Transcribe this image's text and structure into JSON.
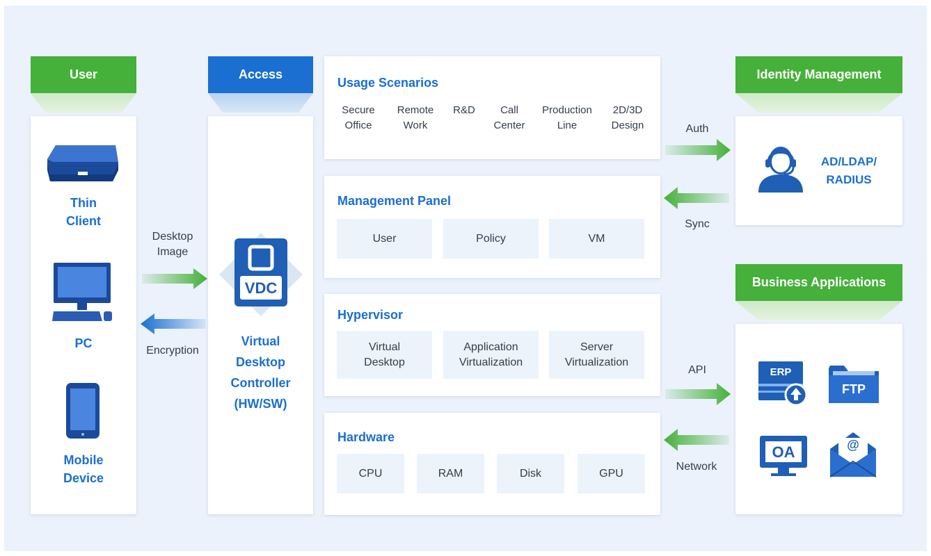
{
  "user_column": {
    "header": "User",
    "items": [
      {
        "label": "Thin\nClient",
        "icon": "thin-client-icon"
      },
      {
        "label": "PC",
        "icon": "pc-icon"
      },
      {
        "label": "Mobile\nDevice",
        "icon": "mobile-device-icon"
      }
    ]
  },
  "access_column": {
    "header": "Access",
    "logo_text": "VDC",
    "label": "Virtual\nDesktop\nController\n(HW/SW)"
  },
  "flows_left": {
    "desktop_image": "Desktop\nImage",
    "encryption": "Encryption"
  },
  "usage_scenarios": {
    "title": "Usage Scenarios",
    "items": [
      "Secure\nOffice",
      "Remote\nWork",
      "R&D",
      "Call\nCenter",
      "Production\nLine",
      "2D/3D\nDesign"
    ]
  },
  "management_panel": {
    "title": "Management Panel",
    "items": [
      "User",
      "Policy",
      "VM"
    ]
  },
  "hypervisor": {
    "title": "Hypervisor",
    "items": [
      "Virtual\nDesktop",
      "Application\nVirtualization",
      "Server\nVirtualization"
    ]
  },
  "hardware": {
    "title": "Hardware",
    "items": [
      "CPU",
      "RAM",
      "Disk",
      "GPU"
    ]
  },
  "flows_right": {
    "auth": "Auth",
    "sync": "Sync",
    "api": "API",
    "network": "Network"
  },
  "identity_management": {
    "header": "Identity Management",
    "label": "AD/LDAP/\nRADIUS"
  },
  "business_applications": {
    "header": "Business Applications",
    "apps": [
      {
        "text": "ERP",
        "icon": "erp-icon"
      },
      {
        "text": "FTP",
        "icon": "ftp-folder-icon"
      },
      {
        "text": "OA",
        "icon": "oa-monitor-icon"
      },
      {
        "text": "@",
        "icon": "email-icon"
      }
    ]
  },
  "colors": {
    "green": "#45b03a",
    "blue": "#1a6fd0",
    "background": "#ebf2fb",
    "box": "#ecf3fb"
  }
}
